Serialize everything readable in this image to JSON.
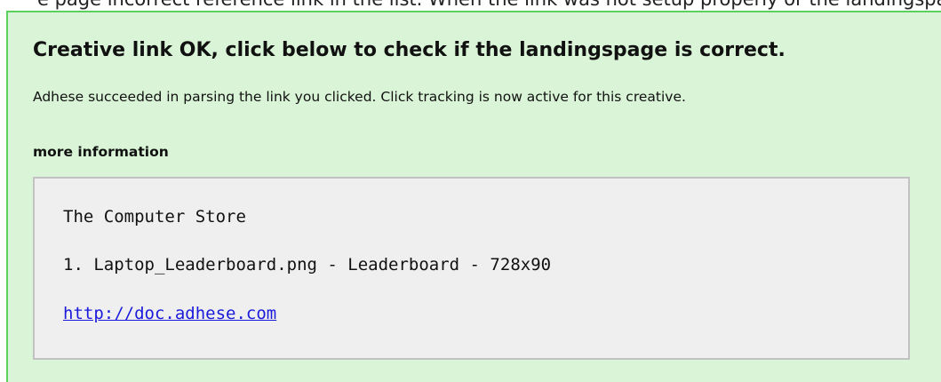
{
  "top_strip_text": "e page incorrect reference link in the list. When the link was not setup properly or the landingspage has appe",
  "panel": {
    "heading": "Creative link OK, click below to check if the landingspage is correct.",
    "description": "Adhese succeeded in parsing the link you clicked. Click tracking is now active for this creative.",
    "more_info_label": "more information",
    "info": {
      "store_name": "The Computer Store",
      "creative_line": "1. Laptop_Leaderboard.png - Leaderboard - 728x90",
      "link_text": "http://doc.adhese.com"
    }
  },
  "colors": {
    "panel_background": "#d9f4d6",
    "panel_border": "#5cd05c",
    "info_background": "#efefef",
    "info_border": "#c2c2c2",
    "link": "#1a1adb"
  }
}
